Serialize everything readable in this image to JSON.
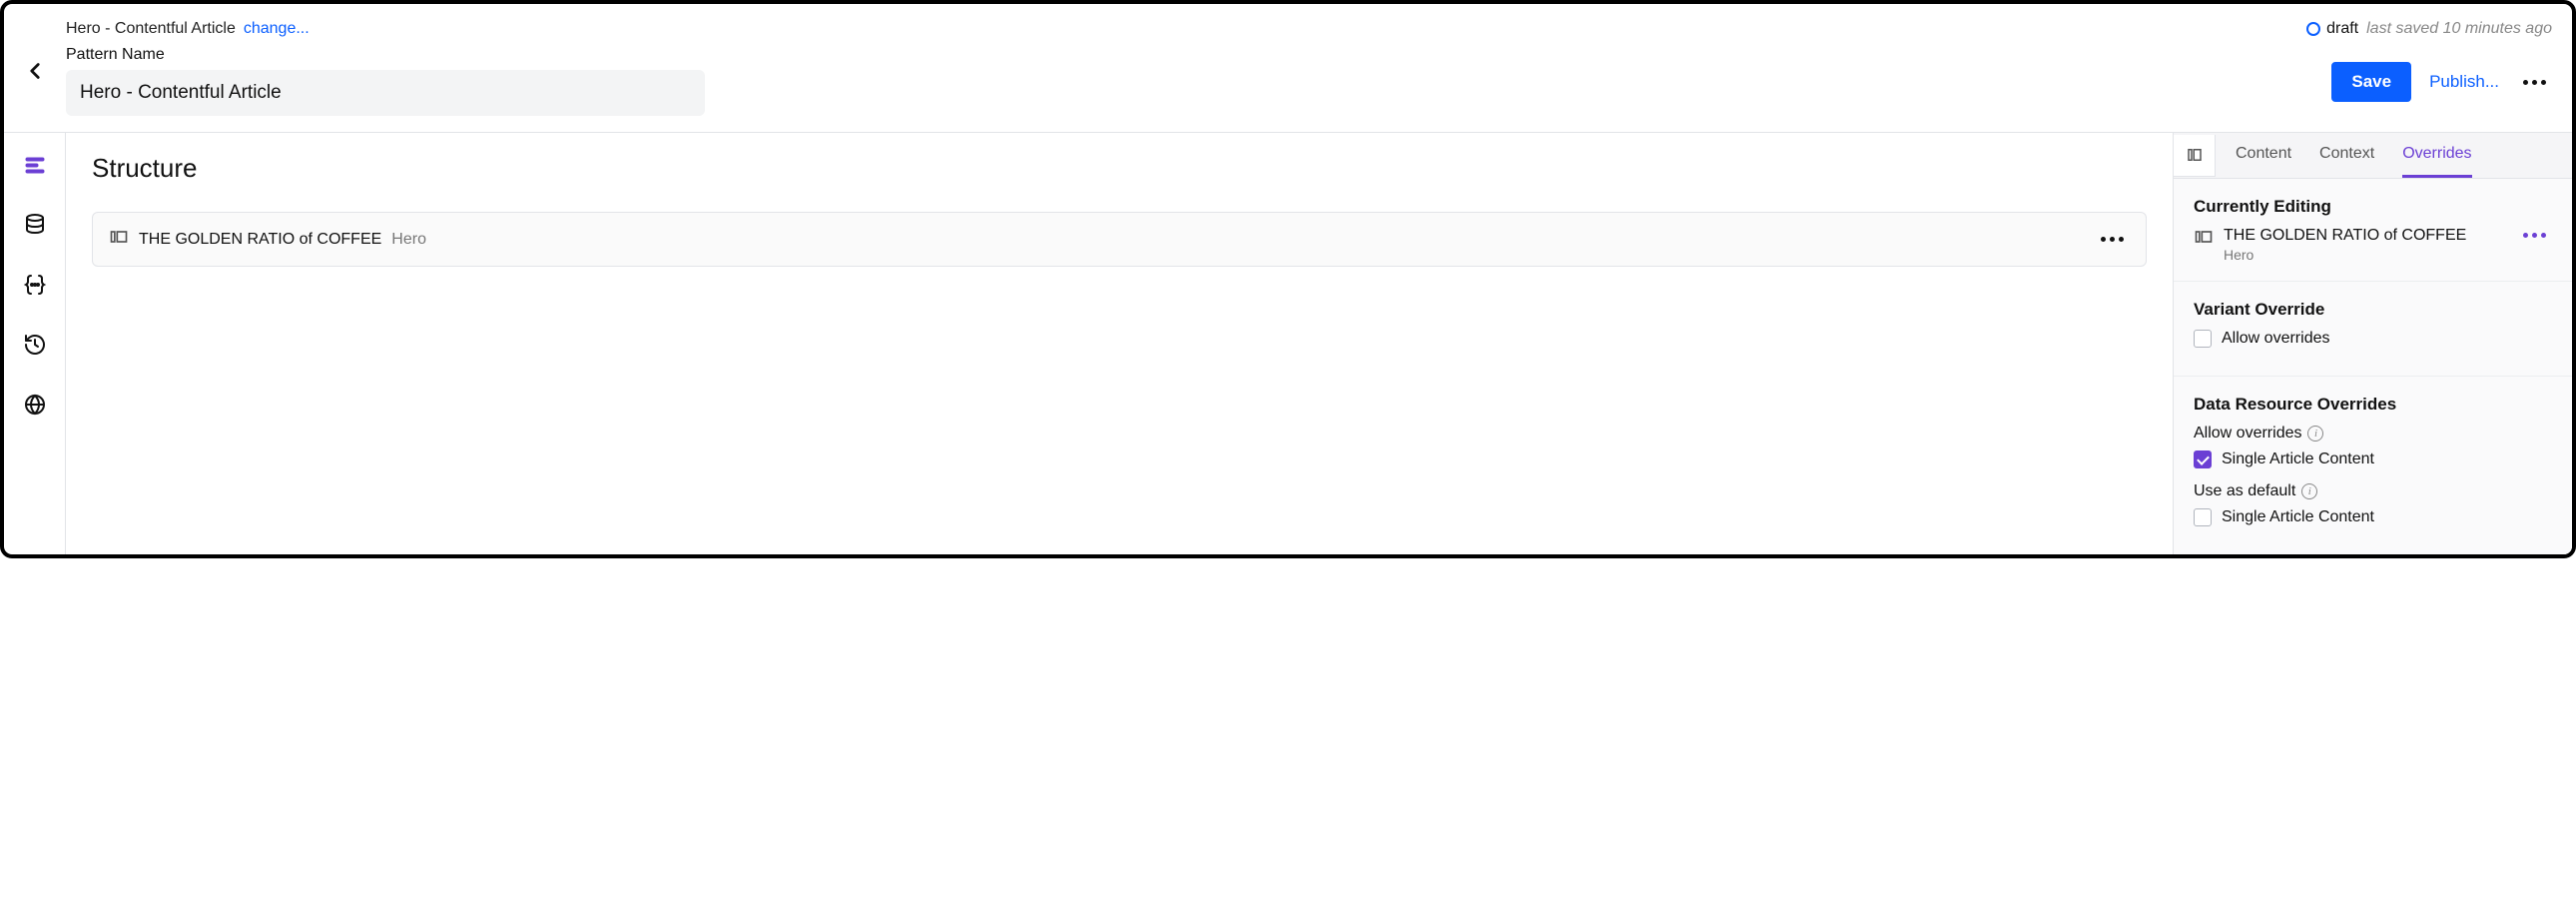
{
  "header": {
    "breadcrumb": "Hero - Contentful Article",
    "change_link": "change...",
    "pattern_label": "Pattern Name",
    "pattern_name": "Hero - Contentful Article",
    "status": {
      "draft_label": "draft",
      "last_saved": "last saved 10 minutes ago"
    },
    "actions": {
      "save": "Save",
      "publish": "Publish..."
    }
  },
  "main": {
    "title": "Structure",
    "item": {
      "label": "THE GOLDEN RATIO of COFFEE",
      "type": "Hero"
    }
  },
  "panel": {
    "tabs": {
      "content": "Content",
      "context": "Context",
      "overrides": "Overrides"
    },
    "currently_editing": {
      "title": "Currently Editing",
      "name": "THE GOLDEN RATIO of COFFEE",
      "type": "Hero"
    },
    "variant_override": {
      "title": "Variant Override",
      "allow_label": "Allow overrides"
    },
    "data_resource": {
      "title": "Data Resource Overrides",
      "allow_heading": "Allow overrides",
      "single_article": "Single Article Content",
      "use_default": "Use as default",
      "single_article2": "Single Article Content"
    }
  }
}
